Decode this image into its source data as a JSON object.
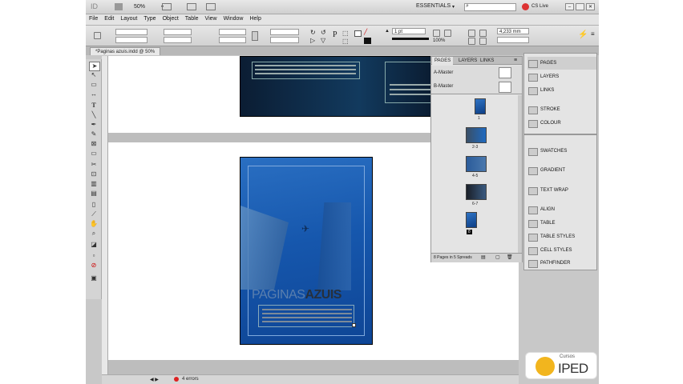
{
  "app": {
    "logo_text": "ID",
    "zoom": "50%",
    "workspace": "ESSENTIALS",
    "cs_live": "CS Live",
    "search_placeholder": ""
  },
  "menu": [
    "File",
    "Edit",
    "Layout",
    "Type",
    "Object",
    "Table",
    "View",
    "Window",
    "Help"
  ],
  "control": {
    "stroke_weight": "1 pt",
    "percent": "100%",
    "measure": "4,233 mm"
  },
  "document": {
    "tab_label": "*Paginas azuis.indd @ 50%",
    "cover_title_light": "PAGINAS",
    "cover_title_bold": "AZUIS"
  },
  "pages_panel": {
    "tabs": [
      "PAGES",
      "LAYERS",
      "LINKS"
    ],
    "masters": [
      "A-Master",
      "B-Master"
    ],
    "spread_labels": [
      "1",
      "2-3",
      "4-5",
      "6-7",
      "8"
    ],
    "footer": "8 Pages in 5 Spreads"
  },
  "side_panels": {
    "group1": [
      "PAGES",
      "LAYERS",
      "LINKS"
    ],
    "group2": [
      "STROKE",
      "COLOUR"
    ],
    "group3": [
      "SWATCHES",
      "GRADIENT",
      "TEXT WRAP",
      "ALIGN",
      "TABLE",
      "TABLE STYLES",
      "CELL STYLES",
      "PATHFINDER"
    ]
  },
  "status": {
    "preflight": "4 errors"
  },
  "watermark": {
    "small": "Cursos",
    "big": "IPED"
  },
  "colors": {
    "accent": "#1e62b8",
    "dark": "#0c1a2e"
  }
}
